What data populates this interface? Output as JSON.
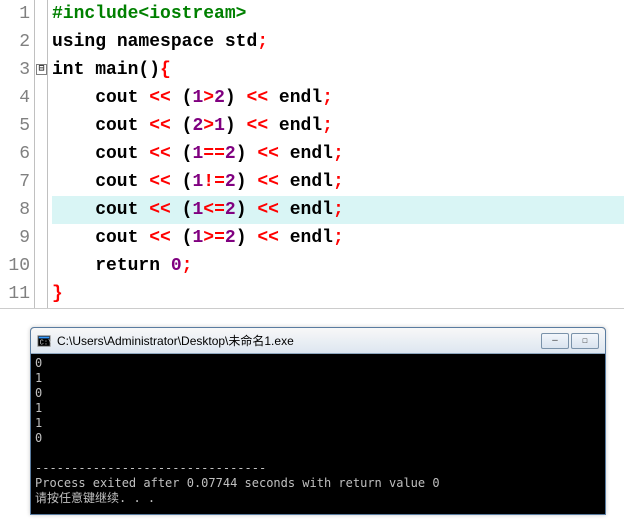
{
  "code": {
    "lines": [
      {
        "n": "1",
        "hl": false,
        "tokens": [
          {
            "t": "#include",
            "c": "c-pre"
          },
          {
            "t": "<iostream>",
            "c": "c-pre"
          }
        ]
      },
      {
        "n": "2",
        "hl": false,
        "tokens": [
          {
            "t": "using",
            "c": "c-kw"
          },
          {
            "t": " ",
            "c": "c-id"
          },
          {
            "t": "namespace",
            "c": "c-kw"
          },
          {
            "t": " std",
            "c": "c-id"
          },
          {
            "t": ";",
            "c": "c-semi"
          }
        ]
      },
      {
        "n": "3",
        "hl": false,
        "fold": true,
        "tokens": [
          {
            "t": "int",
            "c": "c-kw"
          },
          {
            "t": " main",
            "c": "c-id"
          },
          {
            "t": "()",
            "c": "c-par"
          },
          {
            "t": "{",
            "c": "c-brace"
          }
        ]
      },
      {
        "n": "4",
        "hl": false,
        "tokens": [
          {
            "t": "    cout ",
            "c": "c-id"
          },
          {
            "t": "<<",
            "c": "c-op"
          },
          {
            "t": " ",
            "c": "c-id"
          },
          {
            "t": "(",
            "c": "c-par"
          },
          {
            "t": "1",
            "c": "c-num"
          },
          {
            "t": ">",
            "c": "c-op"
          },
          {
            "t": "2",
            "c": "c-num"
          },
          {
            "t": ")",
            "c": "c-par"
          },
          {
            "t": " ",
            "c": "c-id"
          },
          {
            "t": "<<",
            "c": "c-op"
          },
          {
            "t": " endl",
            "c": "c-id"
          },
          {
            "t": ";",
            "c": "c-semi"
          }
        ]
      },
      {
        "n": "5",
        "hl": false,
        "tokens": [
          {
            "t": "    cout ",
            "c": "c-id"
          },
          {
            "t": "<<",
            "c": "c-op"
          },
          {
            "t": " ",
            "c": "c-id"
          },
          {
            "t": "(",
            "c": "c-par"
          },
          {
            "t": "2",
            "c": "c-num"
          },
          {
            "t": ">",
            "c": "c-op"
          },
          {
            "t": "1",
            "c": "c-num"
          },
          {
            "t": ")",
            "c": "c-par"
          },
          {
            "t": " ",
            "c": "c-id"
          },
          {
            "t": "<<",
            "c": "c-op"
          },
          {
            "t": " endl",
            "c": "c-id"
          },
          {
            "t": ";",
            "c": "c-semi"
          }
        ]
      },
      {
        "n": "6",
        "hl": false,
        "tokens": [
          {
            "t": "    cout ",
            "c": "c-id"
          },
          {
            "t": "<<",
            "c": "c-op"
          },
          {
            "t": " ",
            "c": "c-id"
          },
          {
            "t": "(",
            "c": "c-par"
          },
          {
            "t": "1",
            "c": "c-num"
          },
          {
            "t": "==",
            "c": "c-op"
          },
          {
            "t": "2",
            "c": "c-num"
          },
          {
            "t": ")",
            "c": "c-par"
          },
          {
            "t": " ",
            "c": "c-id"
          },
          {
            "t": "<<",
            "c": "c-op"
          },
          {
            "t": " endl",
            "c": "c-id"
          },
          {
            "t": ";",
            "c": "c-semi"
          }
        ]
      },
      {
        "n": "7",
        "hl": false,
        "tokens": [
          {
            "t": "    cout ",
            "c": "c-id"
          },
          {
            "t": "<<",
            "c": "c-op"
          },
          {
            "t": " ",
            "c": "c-id"
          },
          {
            "t": "(",
            "c": "c-par"
          },
          {
            "t": "1",
            "c": "c-num"
          },
          {
            "t": "!=",
            "c": "c-op"
          },
          {
            "t": "2",
            "c": "c-num"
          },
          {
            "t": ")",
            "c": "c-par"
          },
          {
            "t": " ",
            "c": "c-id"
          },
          {
            "t": "<<",
            "c": "c-op"
          },
          {
            "t": " endl",
            "c": "c-id"
          },
          {
            "t": ";",
            "c": "c-semi"
          }
        ]
      },
      {
        "n": "8",
        "hl": true,
        "tokens": [
          {
            "t": "    cout ",
            "c": "c-id"
          },
          {
            "t": "<<",
            "c": "c-op"
          },
          {
            "t": " ",
            "c": "c-id"
          },
          {
            "t": "(",
            "c": "c-par"
          },
          {
            "t": "1",
            "c": "c-num"
          },
          {
            "t": "<=",
            "c": "c-op"
          },
          {
            "t": "2",
            "c": "c-num"
          },
          {
            "t": ")",
            "c": "c-par"
          },
          {
            "t": " ",
            "c": "c-id"
          },
          {
            "t": "<<",
            "c": "c-op"
          },
          {
            "t": " endl",
            "c": "c-id"
          },
          {
            "t": ";",
            "c": "c-semi"
          }
        ]
      },
      {
        "n": "9",
        "hl": false,
        "tokens": [
          {
            "t": "    cout ",
            "c": "c-id"
          },
          {
            "t": "<<",
            "c": "c-op"
          },
          {
            "t": " ",
            "c": "c-id"
          },
          {
            "t": "(",
            "c": "c-par"
          },
          {
            "t": "1",
            "c": "c-num"
          },
          {
            "t": ">=",
            "c": "c-op"
          },
          {
            "t": "2",
            "c": "c-num"
          },
          {
            "t": ")",
            "c": "c-par"
          },
          {
            "t": " ",
            "c": "c-id"
          },
          {
            "t": "<<",
            "c": "c-op"
          },
          {
            "t": " endl",
            "c": "c-id"
          },
          {
            "t": ";",
            "c": "c-semi"
          }
        ]
      },
      {
        "n": "10",
        "hl": false,
        "tokens": [
          {
            "t": "    ",
            "c": "c-id"
          },
          {
            "t": "return",
            "c": "c-kw"
          },
          {
            "t": " ",
            "c": "c-id"
          },
          {
            "t": "0",
            "c": "c-num"
          },
          {
            "t": ";",
            "c": "c-semi"
          }
        ]
      },
      {
        "n": "11",
        "hl": false,
        "tokens": [
          {
            "t": "}",
            "c": "c-brace"
          }
        ]
      }
    ]
  },
  "console": {
    "title": "C:\\Users\\Administrator\\Desktop\\未命名1.exe",
    "output": "0\n1\n0\n1\n1\n0\n\n--------------------------------\nProcess exited after 0.07744 seconds with return value 0\n请按任意键继续. . ."
  },
  "winbtn": {
    "min": "─",
    "max": "☐"
  },
  "foldglyph": "⊟"
}
